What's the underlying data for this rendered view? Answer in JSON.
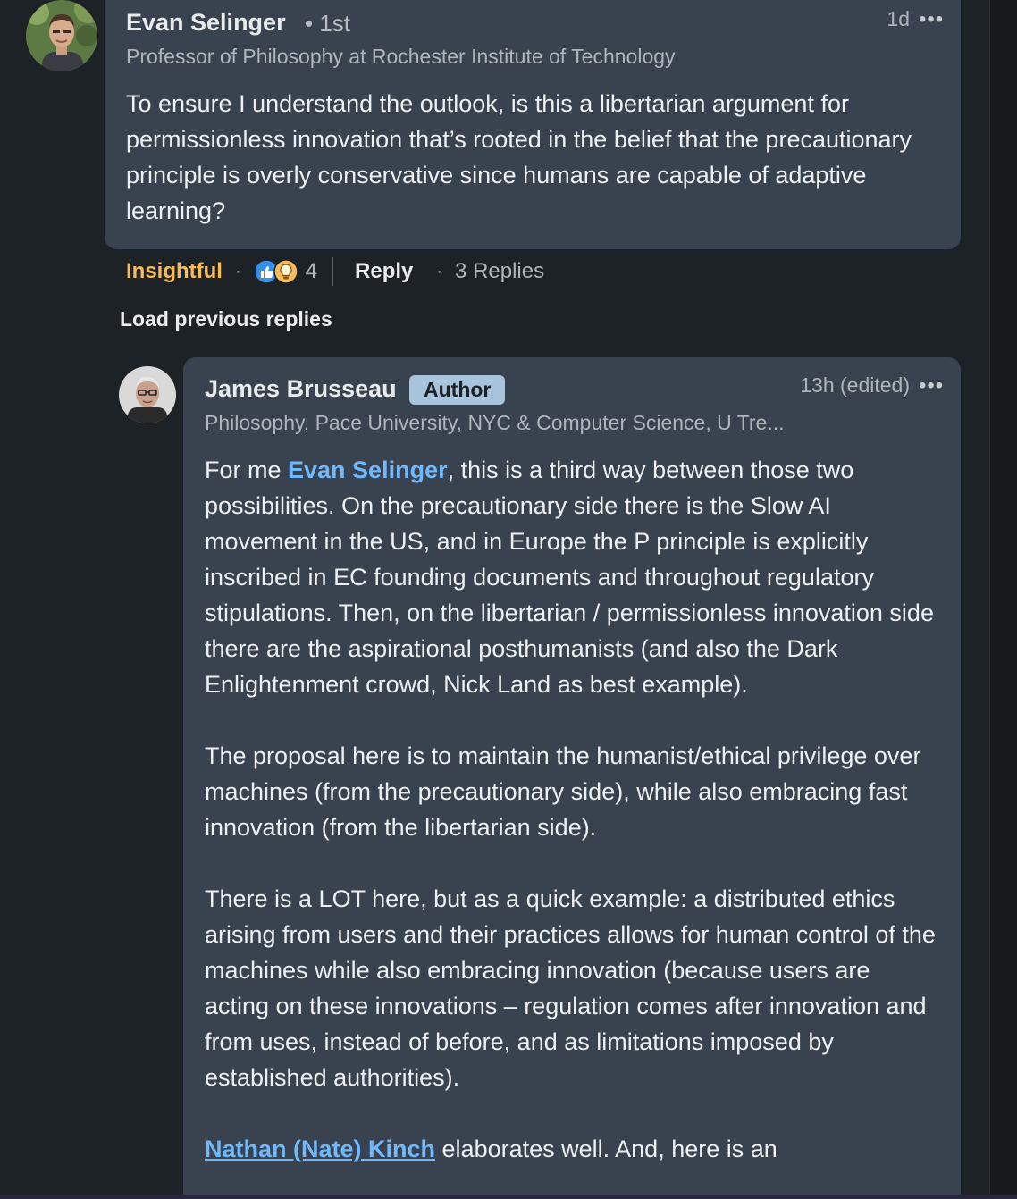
{
  "comment": {
    "author": "Evan Selinger",
    "degree": "• 1st",
    "headline": "Professor of Philosophy at Rochester Institute of Technology",
    "time": "1d",
    "more": "•••",
    "body": "To ensure I understand the outlook, is this a libertarian argument for permissionless innovation that’s rooted in the belief that the precautionary principle is overly conservative since humans are capable of adaptive learning?",
    "actions": {
      "reaction_label": "Insightful",
      "reaction_count": "4",
      "reply_label": "Reply",
      "replies": "3 Replies"
    }
  },
  "load_previous": "Load previous replies",
  "reply": {
    "author": "James Brusseau",
    "badge": "Author",
    "headline": "Philosophy, Pace University, NYC & Computer Science, U Tre...",
    "time": "13h (edited)",
    "more": "•••",
    "p1_prefix": "For me ",
    "p1_mention": "Evan Selinger",
    "p1_rest": ", this is a third way between those two possibilities. On the precautionary side there is the Slow AI movement in the US, and in Europe the P principle is explicitly inscribed in EC founding documents and throughout regulatory stipulations. Then, on the libertarian / permissionless innovation side there are the aspirational posthumanists (and also the Dark Enlightenment crowd, Nick Land as best example).",
    "p2": "The proposal here is to maintain the humanist/ethical privilege over machines (from the precautionary side), while also embracing fast innovation (from the libertarian side).",
    "p3": "There is a LOT here, but as a quick example: a distributed ethics arising from users and their practices allows for human control of the machines while also embracing innovation (because users are acting on these innovations – regulation comes after innovation and from uses, instead of before, and as limitations imposed by established authorities).",
    "p4_mention": "Nathan (Nate) Kinch",
    "p4_rest": " elaborates well. And, here is an"
  },
  "colors": {
    "background": "#1d2226",
    "bubble": "#38434f",
    "mention": "#71b7fb",
    "insightful": "#f5bb5c",
    "author_badge": "#a8c3dc"
  },
  "icons": {
    "reactions": [
      "like-icon",
      "insightful-icon"
    ],
    "more": "more-options-icon"
  }
}
